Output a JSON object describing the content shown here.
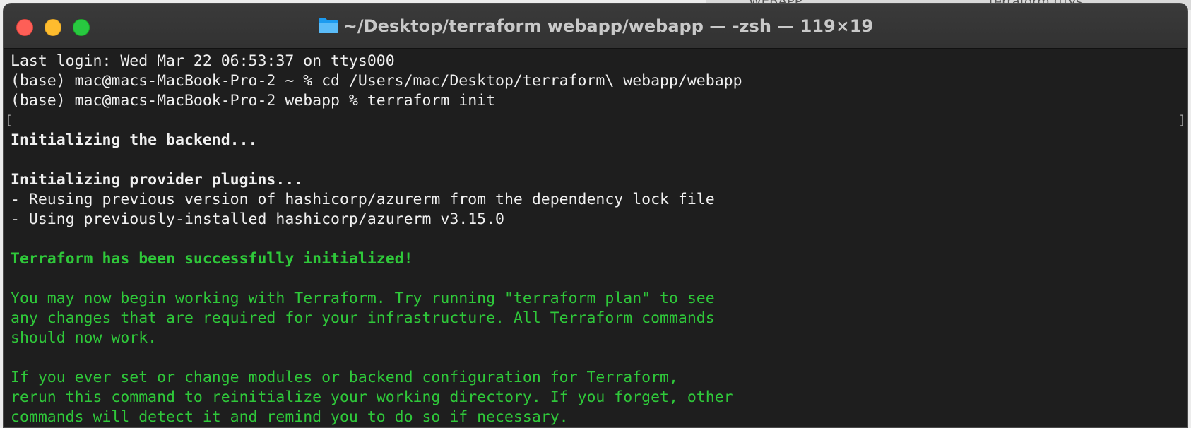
{
  "background": {
    "right_tab_1": "WEBAPP",
    "right_tab_2": "terraform (ttys"
  },
  "window": {
    "title": "~/Desktop/terraform webapp/webapp — -zsh — 119×19",
    "title_icon": "folder-icon",
    "controls": {
      "close_color": "#fe5f57",
      "minimize_color": "#febc2e",
      "zoom_color": "#28c840"
    }
  },
  "terminal": {
    "lines": [
      {
        "text": "Last login: Wed Mar 22 06:53:37 on ttys000",
        "style": "normal"
      },
      {
        "text": "(base) mac@macs-MacBook-Pro-2 ~ % cd /Users/mac/Desktop/terraform\\ webapp/webapp",
        "style": "normal"
      },
      {
        "text": "(base) mac@macs-MacBook-Pro-2 webapp % terraform init",
        "style": "normal"
      },
      {
        "text": "",
        "style": "bracket"
      },
      {
        "text": "Initializing the backend...",
        "style": "bold"
      },
      {
        "text": "",
        "style": "normal"
      },
      {
        "text": "Initializing provider plugins...",
        "style": "bold"
      },
      {
        "text": "- Reusing previous version of hashicorp/azurerm from the dependency lock file",
        "style": "normal"
      },
      {
        "text": "- Using previously-installed hashicorp/azurerm v3.15.0",
        "style": "normal"
      },
      {
        "text": "",
        "style": "normal"
      },
      {
        "text": "Terraform has been successfully initialized!",
        "style": "green-bold"
      },
      {
        "text": "",
        "style": "normal"
      },
      {
        "text": "You may now begin working with Terraform. Try running \"terraform plan\" to see",
        "style": "green"
      },
      {
        "text": "any changes that are required for your infrastructure. All Terraform commands",
        "style": "green"
      },
      {
        "text": "should now work.",
        "style": "green"
      },
      {
        "text": "",
        "style": "normal"
      },
      {
        "text": "If you ever set or change modules or backend configuration for Terraform,",
        "style": "green"
      },
      {
        "text": "rerun this command to reinitialize your working directory. If you forget, other",
        "style": "green"
      },
      {
        "text": "commands will detect it and remind you to do so if necessary.",
        "style": "green"
      }
    ],
    "colors": {
      "background": "#1e1e1e",
      "text": "#f0f0f0",
      "success": "#2fc83a"
    }
  }
}
